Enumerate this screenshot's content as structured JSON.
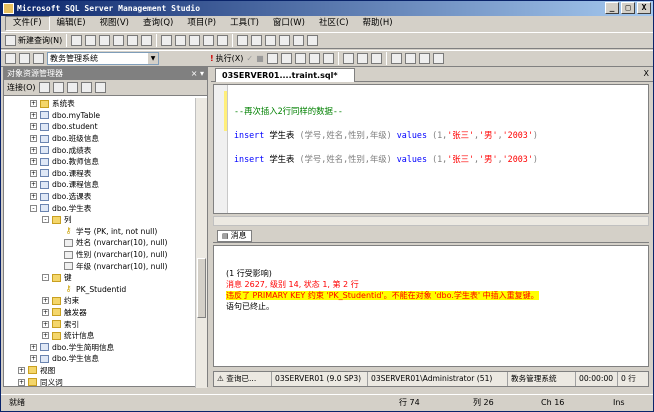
{
  "window": {
    "title": "Microsoft SQL Server Management Studio",
    "min": "_",
    "max": "□",
    "close": "X"
  },
  "menu": [
    "文件(F)",
    "编辑(E)",
    "视图(V)",
    "查询(Q)",
    "项目(P)",
    "工具(T)",
    "窗口(W)",
    "社区(C)",
    "帮助(H)"
  ],
  "toolbar1": {
    "new_query": "新建查询(N)"
  },
  "toolbar2": {
    "database": "教务管理系统",
    "execute": "执行(X)",
    "stop": "■",
    "check": "✓"
  },
  "explorer": {
    "title": "对象资源管理器",
    "connect": "连接(O)",
    "nodes": [
      {
        "label": "系统表",
        "indent": 3,
        "pm": "+",
        "icon": "folder"
      },
      {
        "label": "dbo.myTable",
        "indent": 3,
        "pm": "+",
        "icon": "table"
      },
      {
        "label": "dbo.student",
        "indent": 3,
        "pm": "+",
        "icon": "table"
      },
      {
        "label": "dbo.班级信息",
        "indent": 3,
        "pm": "+",
        "icon": "table"
      },
      {
        "label": "dbo.成绩表",
        "indent": 3,
        "pm": "+",
        "icon": "table"
      },
      {
        "label": "dbo.教师信息",
        "indent": 3,
        "pm": "+",
        "icon": "table"
      },
      {
        "label": "dbo.课程表",
        "indent": 3,
        "pm": "+",
        "icon": "table"
      },
      {
        "label": "dbo.课程信息",
        "indent": 3,
        "pm": "+",
        "icon": "table"
      },
      {
        "label": "dbo.选课表",
        "indent": 3,
        "pm": "+",
        "icon": "table"
      },
      {
        "label": "dbo.学生表",
        "indent": 3,
        "pm": "-",
        "icon": "table"
      },
      {
        "label": "列",
        "indent": 4,
        "pm": "-",
        "icon": "folder"
      },
      {
        "label": "学号 (PK, int, not null)",
        "indent": 5,
        "pm": "",
        "icon": "key"
      },
      {
        "label": "姓名 (nvarchar(10), null)",
        "indent": 5,
        "pm": "",
        "icon": "col"
      },
      {
        "label": "性别 (nvarchar(10), null)",
        "indent": 5,
        "pm": "",
        "icon": "col"
      },
      {
        "label": "年级 (nvarchar(10), null)",
        "indent": 5,
        "pm": "",
        "icon": "col"
      },
      {
        "label": "键",
        "indent": 4,
        "pm": "-",
        "icon": "folder"
      },
      {
        "label": "PK_Studentid",
        "indent": 5,
        "pm": "",
        "icon": "key"
      },
      {
        "label": "约束",
        "indent": 4,
        "pm": "+",
        "icon": "folder"
      },
      {
        "label": "触发器",
        "indent": 4,
        "pm": "+",
        "icon": "folder"
      },
      {
        "label": "索引",
        "indent": 4,
        "pm": "+",
        "icon": "folder"
      },
      {
        "label": "统计信息",
        "indent": 4,
        "pm": "+",
        "icon": "folder"
      },
      {
        "label": "dbo.学生简明信息",
        "indent": 3,
        "pm": "+",
        "icon": "table"
      },
      {
        "label": "dbo.学生信息",
        "indent": 3,
        "pm": "+",
        "icon": "table"
      },
      {
        "label": "视图",
        "indent": 2,
        "pm": "+",
        "icon": "folder"
      },
      {
        "label": "同义词",
        "indent": 2,
        "pm": "+",
        "icon": "folder"
      }
    ]
  },
  "tab": {
    "label": "03SERVER01....traint.sql*",
    "close": "X"
  },
  "editor": {
    "comment": "--再次插入2行同样的数据--",
    "line_prefix_kw": "insert",
    "line_table": "学生表",
    "line_cols": "(学号,姓名,性别,年级)",
    "line_values_kw": "values",
    "line_vals_open": "(1,",
    "line_val_name": "'张三'",
    "line_comma": ",",
    "line_val_sex": "'男'",
    "line_comma2": ",",
    "line_val_year": "'2003'",
    "line_close": ")"
  },
  "messages": {
    "tab_label": "消息",
    "line1": "(1 行受影响)",
    "line2": "消息 2627, 级别 14, 状态 1, 第 2 行",
    "line3_pre": "违反了 PRIMARY KEY 约束 'PK_Studentid'。不能在对象 'dbo.学生表' 中插入重复键。",
    "line4": "语句已终止。"
  },
  "querystatus": {
    "state": "查询已...",
    "server": "03SERVER01 (9.0 SP3)",
    "user": "03SERVER01\\Administrator (51)",
    "db": "教务管理系统",
    "time": "00:00:00",
    "rows": "0 行"
  },
  "statusbar": {
    "ready": "就绪",
    "row": "行 74",
    "col": "列 26",
    "ch": "Ch 16",
    "ins": "Ins"
  }
}
